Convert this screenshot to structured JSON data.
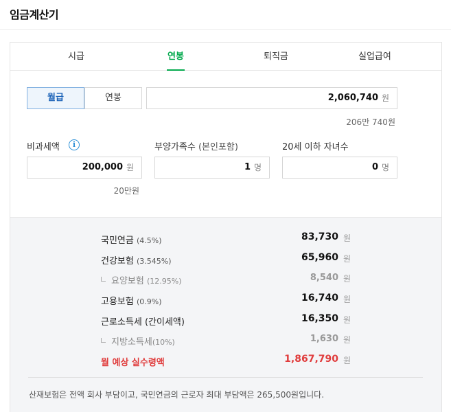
{
  "header": {
    "title": "임금계산기"
  },
  "tabs": [
    {
      "label": "시급"
    },
    {
      "label": "연봉"
    },
    {
      "label": "퇴직금"
    },
    {
      "label": "실업급여"
    }
  ],
  "active_tab": "연봉",
  "salary_type": {
    "options": [
      "월급",
      "연봉"
    ],
    "selected": "월급"
  },
  "salary_input": {
    "value": "2,060,740",
    "unit": "원",
    "hint": "206만 740원"
  },
  "nontax": {
    "label": "비과세액",
    "value": "200,000",
    "unit": "원",
    "hint": "20만원"
  },
  "dependents": {
    "label": "부양가족수",
    "label_note": "(본인포함)",
    "value": "1",
    "unit": "명"
  },
  "children": {
    "label": "20세 이하 자녀수",
    "value": "0",
    "unit": "명"
  },
  "results": [
    {
      "label": "국민연금",
      "rate": "(4.5%)",
      "value": "83,730",
      "unit": "원"
    },
    {
      "label": "건강보험",
      "rate": "(3.545%)",
      "value": "65,960",
      "unit": "원"
    },
    {
      "label": "요양보험",
      "rate": "(12.95%)",
      "value": "8,540",
      "unit": "원"
    },
    {
      "label": "고용보험",
      "rate": "(0.9%)",
      "value": "16,740",
      "unit": "원"
    },
    {
      "label": "근로소득세",
      "rate": "(간이세액)",
      "value": "16,350",
      "unit": "원"
    },
    {
      "label": "지방소득세",
      "rate": "(10%)",
      "value": "1,630",
      "unit": "원"
    },
    {
      "label": "월 예상 실수령액",
      "rate": "",
      "value": "1,867,790",
      "unit": "원"
    }
  ],
  "footnote": "산재보험은 전액 회사 부담이고, 국민연금의 근로자 최대 부담액은 265,500원입니다.",
  "colors": {
    "accent_green": "#03a94d",
    "selected_blue": "#1c63b8",
    "highlight_red": "#e03c3c",
    "info_blue": "#2a8fd6"
  },
  "icons": {
    "info": "info-circle-icon",
    "sub_row": "corner-indent-icon"
  }
}
